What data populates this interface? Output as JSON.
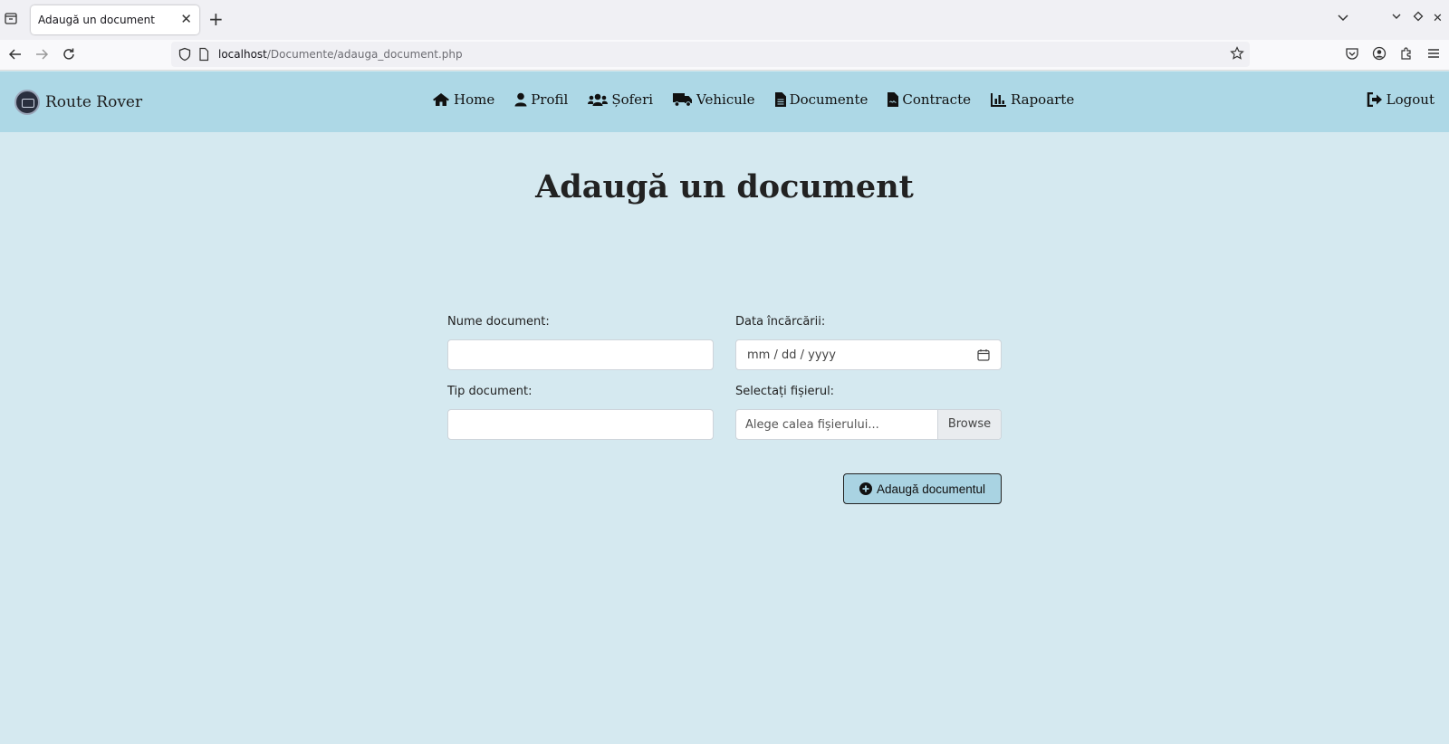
{
  "browser": {
    "tab_title": "Adaugă un document",
    "url_host": "localhost",
    "url_path": "/Documente/adauga_document.php"
  },
  "site": {
    "brand": "Route Rover",
    "menu": [
      {
        "label": "Home",
        "icon": "home-icon"
      },
      {
        "label": "Profil",
        "icon": "user-icon"
      },
      {
        "label": "Șoferi",
        "icon": "users-icon"
      },
      {
        "label": "Vehicule",
        "icon": "truck-icon"
      },
      {
        "label": "Documente",
        "icon": "file-icon"
      },
      {
        "label": "Contracte",
        "icon": "contract-icon"
      },
      {
        "label": "Rapoarte",
        "icon": "chart-icon"
      }
    ],
    "logout": "Logout"
  },
  "page": {
    "title": "Adaugă un document"
  },
  "form": {
    "name_label": "Nume document:",
    "name_value": "",
    "date_label": "Data încărcării:",
    "date_placeholder": "mm / dd / yyyy",
    "type_label": "Tip document:",
    "type_value": "",
    "file_label": "Selectați fișierul:",
    "file_placeholder": "Alege calea fișierului...",
    "browse_label": "Browse",
    "submit_label": "Adaugă documentul"
  },
  "colors": {
    "header_bg": "#add8e6",
    "page_bg": "#d5e9f0",
    "button_bg": "#a9d3e2"
  }
}
